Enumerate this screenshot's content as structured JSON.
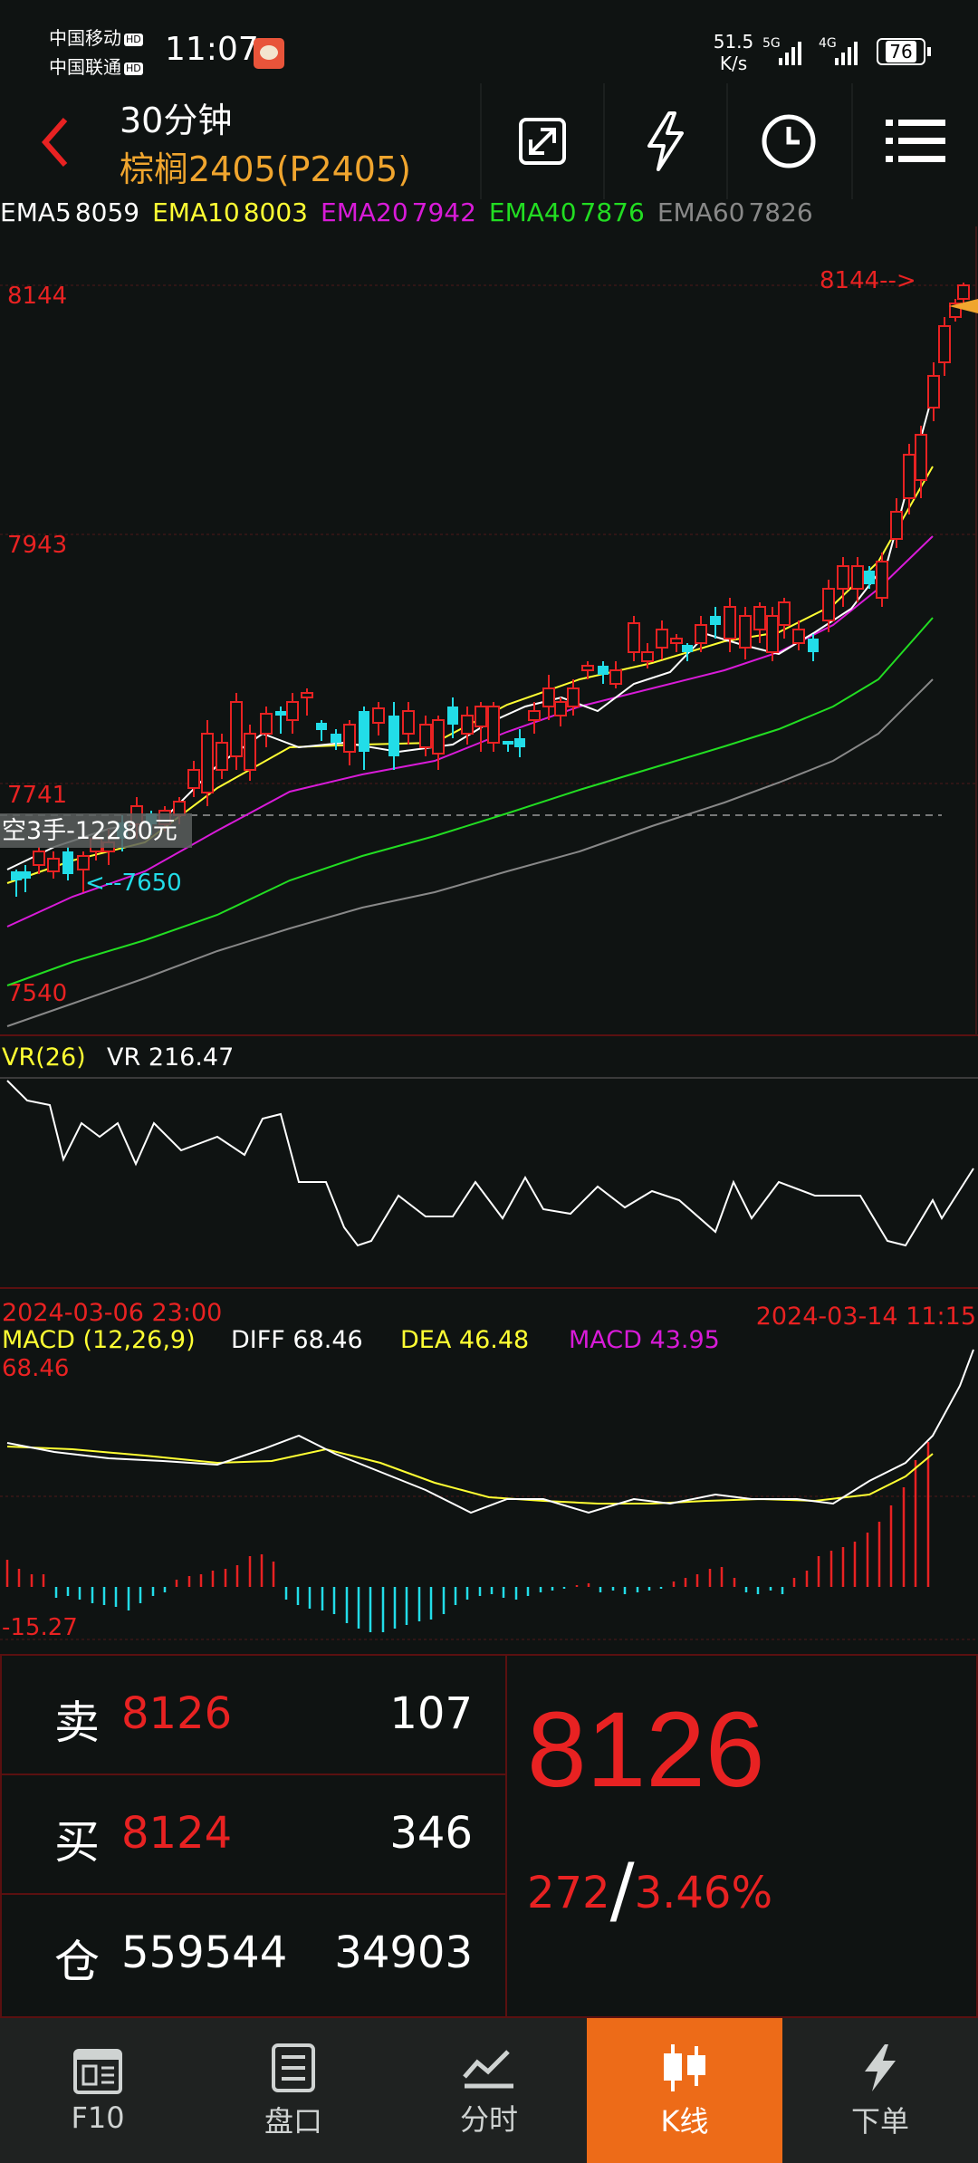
{
  "status_bar": {
    "carrier1": "中国移动",
    "carrier2": "中国联通",
    "hd": "HD",
    "time": "11:07",
    "speed_value": "51.5",
    "speed_unit": "K/s",
    "net1": "5G",
    "net2": "4G",
    "battery": "76"
  },
  "header": {
    "period": "30分钟",
    "instrument": "棕榈2405(P2405)"
  },
  "ema": [
    {
      "label": "EMA5",
      "value": "8059",
      "color": "#ffffff"
    },
    {
      "label": "EMA10",
      "value": "8003",
      "color": "#ffff33"
    },
    {
      "label": "EMA20",
      "value": "7942",
      "color": "#d81bd8"
    },
    {
      "label": "EMA40",
      "value": "7876",
      "color": "#22dd22"
    },
    {
      "label": "EMA60",
      "value": "7826",
      "color": "#888888"
    }
  ],
  "main_chart": {
    "price_labels": [
      "8144",
      "7943",
      "7741",
      "7540"
    ],
    "high_marker": "8144-->",
    "low_marker": "<--7650",
    "position_label": "空3手-12280元"
  },
  "vr": {
    "title": "VR(26)",
    "value_text": "VR 216.47"
  },
  "macd": {
    "start_time": "2024-03-06 23:00",
    "end_time": "2024-03-14 11:15",
    "title": "MACD (12,26,9)",
    "diff": "DIFF 68.46",
    "dea": "DEA 46.48",
    "macd": "MACD 43.95",
    "max_label": "68.46",
    "min_label": "-15.27"
  },
  "quote": {
    "sell_label": "卖",
    "sell_price": "8126",
    "sell_vol": "107",
    "buy_label": "买",
    "buy_price": "8124",
    "buy_vol": "346",
    "oi_label": "仓",
    "oi_value": "559544",
    "oi_change": "34903",
    "last_price": "8126",
    "change": "272",
    "change_pct": "3.46%"
  },
  "nav": {
    "f10": "F10",
    "pankou": "盘口",
    "fenshi": "分时",
    "kline": "K线",
    "order": "下单"
  },
  "colors": {
    "up": "#e82222",
    "down": "#22dde8",
    "accent": "#ed6b18",
    "instrument": "#f0a52e"
  }
}
